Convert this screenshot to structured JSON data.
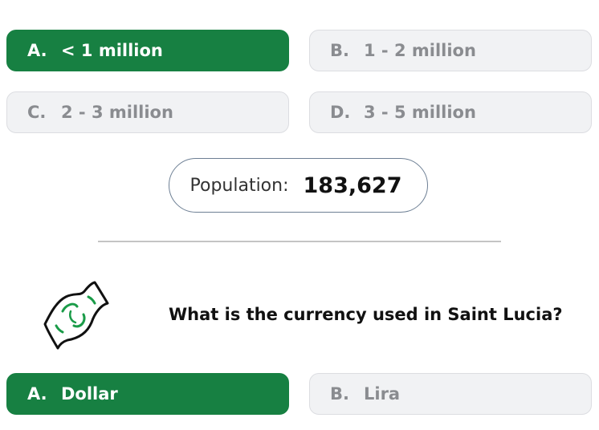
{
  "question1": {
    "options": [
      {
        "letter": "A.",
        "label": "< 1 million"
      },
      {
        "letter": "B.",
        "label": "1 - 2 million"
      },
      {
        "letter": "C.",
        "label": "2 - 3 million"
      },
      {
        "letter": "D.",
        "label": "3 - 5 million"
      }
    ],
    "selected": "A."
  },
  "population": {
    "label": "Population:",
    "value": "183,627"
  },
  "question2": {
    "icon": "money-bill-icon",
    "text": "What is the currency used in Saint Lucia?",
    "options": [
      {
        "letter": "A.",
        "label": "Dollar"
      },
      {
        "letter": "B.",
        "label": "Lira"
      }
    ],
    "selected": "A."
  },
  "colors": {
    "selected": "#178042",
    "option_bg": "#f1f2f4",
    "option_text": "#8a8c90",
    "money_green": "#1a9b48"
  }
}
